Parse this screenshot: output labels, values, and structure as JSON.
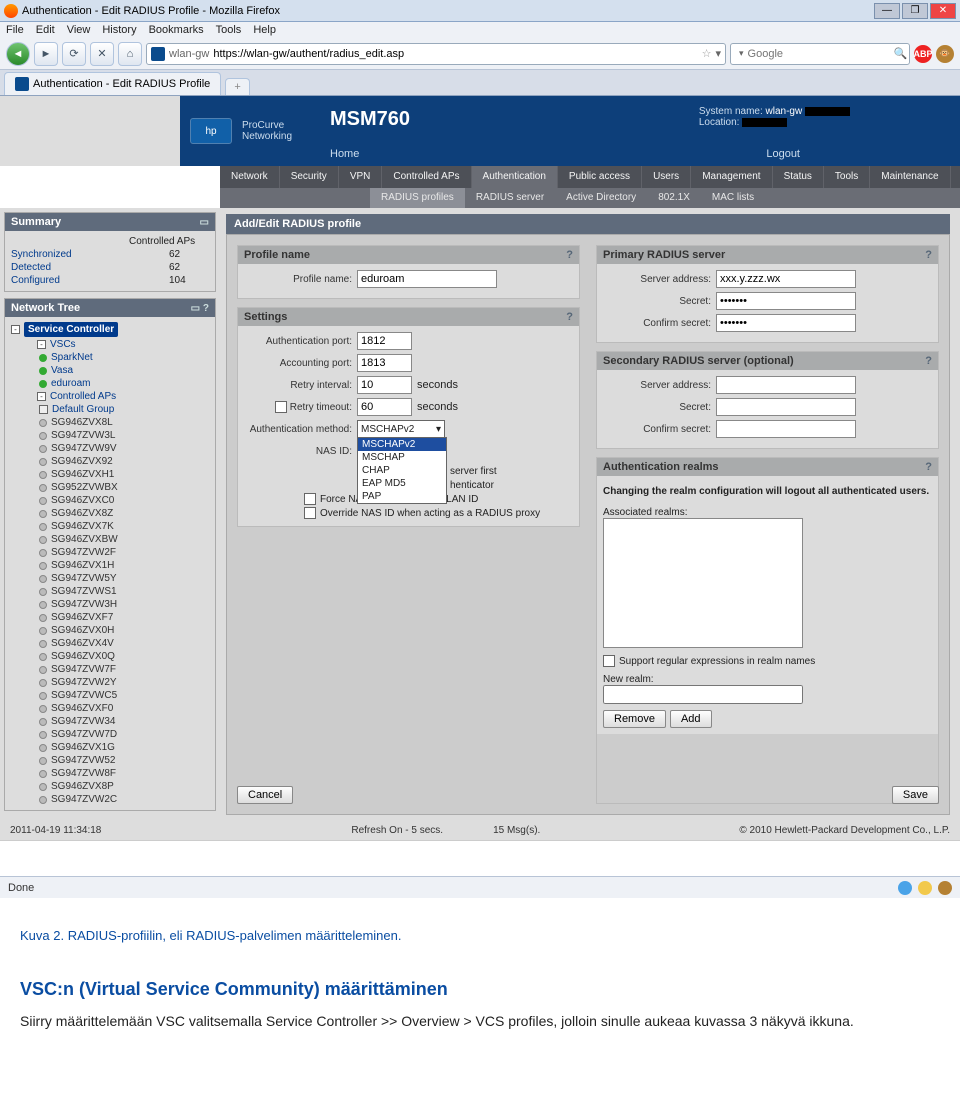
{
  "browser": {
    "title": "Authentication - Edit RADIUS Profile - Mozilla Firefox",
    "menubar": [
      "File",
      "Edit",
      "View",
      "History",
      "Bookmarks",
      "Tools",
      "Help"
    ],
    "url": "https://wlan-gw/authent/radius_edit.asp",
    "search_placeholder": "Google",
    "tab_label": "Authentication - Edit RADIUS Profile",
    "status": "Done"
  },
  "hp": {
    "brand1": "ProCurve",
    "brand2": "Networking",
    "model": "MSM760",
    "nav_home": "Home",
    "nav_logout": "Logout",
    "sysname_label": "System name:",
    "sysname": "wlan-gw",
    "location_label": "Location:"
  },
  "nav": {
    "main": [
      "Network",
      "Security",
      "VPN",
      "Controlled APs",
      "Authentication",
      "Public access",
      "Users",
      "Management",
      "Status",
      "Tools",
      "Maintenance"
    ],
    "main_active": "Authentication",
    "sub": [
      "RADIUS profiles",
      "RADIUS server",
      "Active Directory",
      "802.1X",
      "MAC lists"
    ],
    "sub_active": "RADIUS profiles"
  },
  "summary": {
    "title": "Summary",
    "col_header": "Controlled APs",
    "rows": [
      {
        "k": "Synchronized",
        "v": "62"
      },
      {
        "k": "Detected",
        "v": "62"
      },
      {
        "k": "Configured",
        "v": "104"
      }
    ]
  },
  "tree": {
    "title": "Network Tree",
    "root": "Service Controller",
    "vscs_label": "VSCs",
    "vscs": [
      "SparkNet",
      "Vasa",
      "eduroam"
    ],
    "aps_label": "Controlled APs",
    "default_group": "Default Group",
    "aps": [
      "SG946ZVX8L",
      "SG947ZVW3L",
      "SG947ZVW9V",
      "SG946ZVX92",
      "SG946ZVXH1",
      "SG952ZVWBX",
      "SG946ZVXC0",
      "SG946ZVX8Z",
      "SG946ZVX7K",
      "SG946ZVXBW",
      "SG947ZVW2F",
      "SG946ZVX1H",
      "SG947ZVW5Y",
      "SG947ZVWS1",
      "SG947ZVW3H",
      "SG946ZVXF7",
      "SG946ZVX0H",
      "SG946ZVX4V",
      "SG946ZVX0Q",
      "SG947ZVW7F",
      "SG947ZVW2Y",
      "SG947ZVWC5",
      "SG946ZVXF0",
      "SG947ZVW34",
      "SG947ZVW7D",
      "SG946ZVX1G",
      "SG947ZVW52",
      "SG947ZVW8F",
      "SG946ZVX8P",
      "SG947ZVW2C"
    ]
  },
  "form": {
    "header": "Add/Edit RADIUS profile",
    "profile_section": "Profile name",
    "profile_name_label": "Profile name:",
    "profile_name": "eduroam",
    "settings_section": "Settings",
    "auth_port_label": "Authentication port:",
    "auth_port": "1812",
    "acct_port_label": "Accounting port:",
    "acct_port": "1813",
    "retry_interval_label": "Retry interval:",
    "retry_interval": "10",
    "seconds": "seconds",
    "retry_timeout_label": "Retry timeout:",
    "retry_timeout": "60",
    "auth_method_label": "Authentication method:",
    "auth_method": "MSCHAPv2",
    "auth_method_options": [
      "MSCHAPv2",
      "MSCHAP",
      "CHAP",
      "EAP MD5",
      "PAP"
    ],
    "nas_id_label": "NAS ID:",
    "chk_server_first": "server first",
    "chk_authenticator": "henticator",
    "chk_force_nas": "Force NAS-Port to ingress VLAN ID",
    "chk_override_nas": "Override NAS ID when acting as a RADIUS proxy",
    "primary_section": "Primary RADIUS server",
    "server_addr_label": "Server address:",
    "server_addr": "xxx.y.zzz.wx",
    "secret_label": "Secret:",
    "secret": "*******",
    "confirm_label": "Confirm secret:",
    "confirm": "*******",
    "secondary_section": "Secondary RADIUS server (optional)",
    "realms_section": "Authentication realms",
    "realms_note": "Changing the realm configuration will logout all authenticated users.",
    "assoc_label": "Associated realms:",
    "regex_label": "Support regular expressions in realm names",
    "new_realm_label": "New realm:",
    "btn_remove": "Remove",
    "btn_add": "Add",
    "btn_cancel": "Cancel",
    "btn_save": "Save"
  },
  "status_page": {
    "timestamp": "2011-04-19 11:34:18",
    "refresh": "Refresh On - 5 secs.",
    "msgs": "15 Msg(s).",
    "copyright": "© 2010 Hewlett-Packard Development Co., L.P."
  },
  "article": {
    "caption": "Kuva 2. RADIUS-profiilin, eli RADIUS-palvelimen määritteleminen.",
    "heading": "VSC:n (Virtual Service Community) määrittäminen",
    "body": "Siirry määrittelemään VSC valitsemalla Service Controller >> Overview > VCS profiles, jolloin sinulle aukeaa kuvassa 3 näkyvä ikkuna."
  }
}
